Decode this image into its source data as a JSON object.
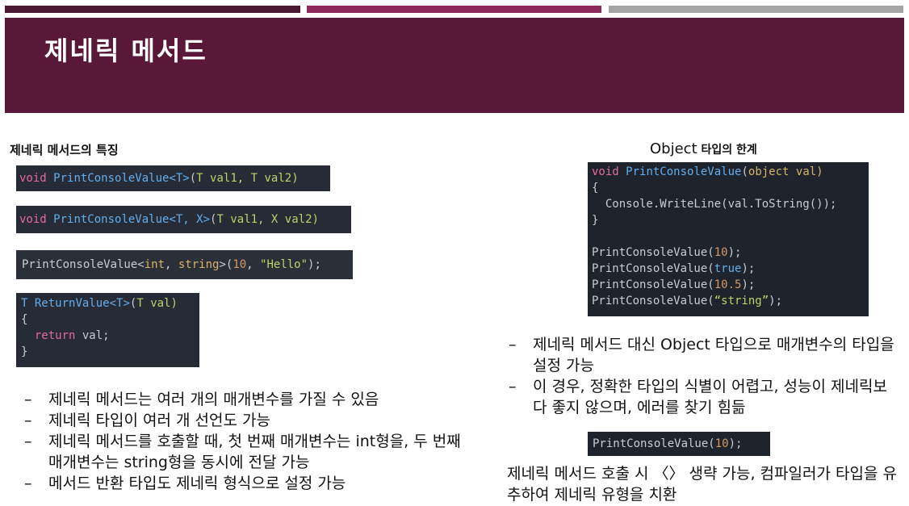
{
  "slide": {
    "title": "제네릭 메서드",
    "left_heading": "제네릭 메서드의 특징",
    "right_heading_word": "Object",
    "right_heading_rest": " 타입의 한계"
  },
  "code": {
    "c1": {
      "kw": "void",
      "fn": "PrintConsoleValue<T>",
      "params_open": "(",
      "t1": "T",
      "p1": " val1, ",
      "t2": "T",
      "p2": " val2)"
    },
    "c2": {
      "kw": "void",
      "fn": "PrintConsoleValue<T, X>",
      "params_open": "(",
      "t1": "T",
      "p1": " val1, ",
      "t2": "X",
      "p2": " val2)"
    },
    "c3": {
      "fn": "PrintConsoleValue<",
      "t1": "int",
      "sep": ", ",
      "t2": "string",
      "close": ">(",
      "num": "10",
      "comma": ", ",
      "str": "\"Hello\"",
      "end": ");"
    },
    "c4": {
      "ret": "T",
      "fn": "ReturnValue<T>",
      "open": "(",
      "t1": "T",
      "p1": " val)",
      "lbrace": "{",
      "kw": "return",
      "body": " val;",
      "rbrace": "}"
    },
    "c5": {
      "kw": "void",
      "fn": "PrintConsoleValue",
      "open": "(",
      "obj": "object",
      "param": " val)",
      "lbrace": "{",
      "line": "  Console.WriteLine(val.ToString());",
      "rbrace": "}",
      "calls": [
        {
          "fn": "PrintConsoleValue(",
          "arg": "10",
          "end": ");"
        },
        {
          "fn": "PrintConsoleValue(",
          "arg": "true",
          "end": ");"
        },
        {
          "fn": "PrintConsoleValue(",
          "arg": "10.5",
          "end": ");"
        },
        {
          "fn": "PrintConsoleValue(",
          "arg": "“string”",
          "end": ");"
        }
      ]
    },
    "c6": {
      "fn": "PrintConsoleValue(",
      "arg": "10",
      "end": ");"
    }
  },
  "left_bullets": [
    "제네릭 메서드는 여러 개의 매개변수를 가질 수 있음",
    "제네릭 타입이 여러 개 선언도 가능",
    "제네릭 메서드를 호출할 때, 첫 번째 매개변수는 int형을, 두 번째 매개변수는 string형을 동시에 전달 가능",
    "메서드 반환 타입도 제네릭 형식으로 설정 가능"
  ],
  "right_bullets": [
    "제네릭 메서드 대신 Object 타입으로 매개변수의 타입을 설정 가능",
    "이 경우, 정확한 타입의 식별이 어렵고, 성능이 제네릭보다 좋지 않으며, 에러를 찾기 힘듦"
  ],
  "note": "제네릭 메서드 호출 시 〈〉 생략 가능, 컴파일러가 타입을 유추하여 제네릭 유형을 치환",
  "colors": {
    "title_band": "#5a1838",
    "bar1": "#4a1830",
    "bar2": "#8c2b5a",
    "bar3": "#a5a5a5",
    "code_bg": "#262b35"
  }
}
